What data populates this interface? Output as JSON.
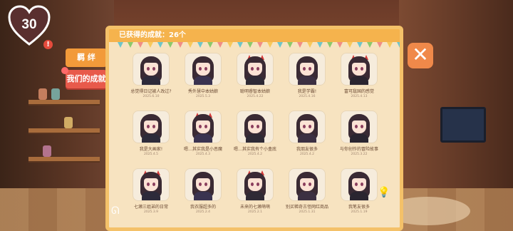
{
  "hud": {
    "hearts": "30",
    "alert": "!"
  },
  "tabs": [
    {
      "label": "羁 绊"
    },
    {
      "label": "我们的成就"
    }
  ],
  "panel": {
    "header": "已获得的成就：26个"
  },
  "achievements": [
    {
      "title": "总觉得日记被人改过?",
      "date": "2025.6.10"
    },
    {
      "title": "秀外慧中本姑娘",
      "date": "2025.5.3"
    },
    {
      "title": "聪明睿智本姑娘",
      "date": "2025.4.22"
    },
    {
      "title": "我是学霸!",
      "date": "2025.4.16"
    },
    {
      "title": "富可敌国的感觉",
      "date": "2025.4.13"
    },
    {
      "title": "我是大画家!",
      "date": "2025.4.5"
    },
    {
      "title": "嗯…其实我是小恶魔",
      "date": "2025.4.3"
    },
    {
      "title": "嗯…其实我有个小盒底",
      "date": "2025.4.2"
    },
    {
      "title": "我朋友很多",
      "date": "2025.4.2"
    },
    {
      "title": "与你创作的冒险故事",
      "date": "2025.3.22"
    },
    {
      "title": "七濑三姐弟的日常",
      "date": "2025.3.9"
    },
    {
      "title": "我衣服超多的",
      "date": "2025.2.4"
    },
    {
      "title": "未来的七濑萌萌",
      "date": "2025.2.1"
    },
    {
      "title": "别买稀奇古怪网红商品",
      "date": "2025.1.31"
    },
    {
      "title": "我笔友很多",
      "date": "2025.1.19"
    }
  ],
  "icons": {
    "close": "close-icon",
    "heart": "heart-icon",
    "bunny": "bunny-icon",
    "bulb": "lightbulb-icon"
  },
  "colors": {
    "accent_orange": "#f29a3a",
    "accent_red": "#e85a4b",
    "panel_bg": "#f7e3c0",
    "panel_border": "#f4c169"
  }
}
